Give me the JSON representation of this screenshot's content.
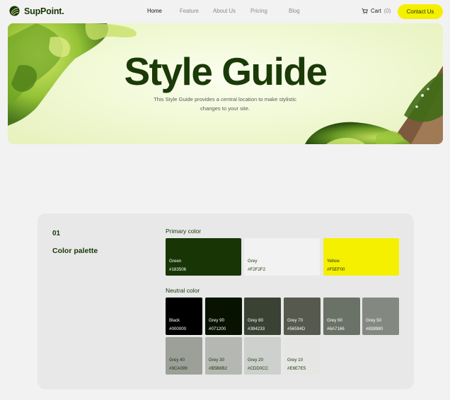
{
  "nav": {
    "logo_text": "SupPoint.",
    "menu": [
      "Home",
      "Feature",
      "About Us",
      "Pricing",
      "Blog"
    ],
    "cart_label": "Cart",
    "cart_count": "(0)",
    "cta_label": "Contact Us"
  },
  "hero": {
    "title": "Style Guide",
    "subtitle": "This Style Guide provides a central location to make stylistic changes to your site."
  },
  "palette": {
    "number": "01",
    "title": "Color palette",
    "primary_label": "Primary color",
    "neutral_label": "Neutral color",
    "primary": [
      {
        "name": "Green",
        "hex": "#183506"
      },
      {
        "name": "Grey",
        "hex": "#F2F2F2"
      },
      {
        "name": "Yellow",
        "hex": "#F5EF00"
      }
    ],
    "neutral": [
      {
        "name": "Black",
        "hex": "#000000"
      },
      {
        "name": "Grey 90",
        "hex": "#071200"
      },
      {
        "name": "Grey 80",
        "hex": "#394233"
      },
      {
        "name": "Grey 70",
        "hex": "#56594D"
      },
      {
        "name": "Grey 60",
        "hex": "#6A7166"
      },
      {
        "name": "Grey 50",
        "hex": "#838980"
      },
      {
        "name": "Grey 40",
        "hex": "#9CA099"
      },
      {
        "name": "Grey 30",
        "hex": "#B5B8B2"
      },
      {
        "name": "Grey 20",
        "hex": "#CDD0CC"
      },
      {
        "name": "Grey 10",
        "hex": "#E6E7E5"
      }
    ]
  }
}
